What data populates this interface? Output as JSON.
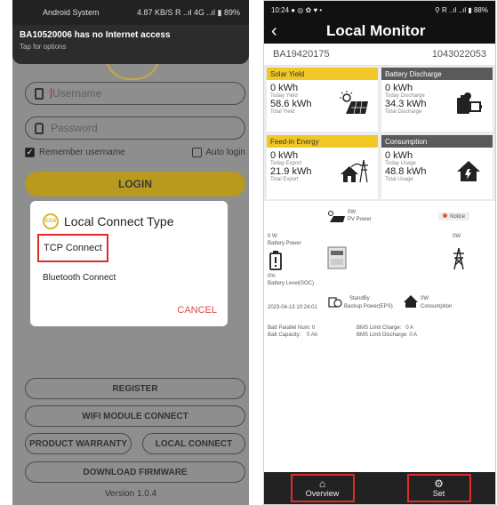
{
  "left": {
    "status_bar": {
      "app": "Android System",
      "speed": "4.87 KB/S",
      "battery": "89%"
    },
    "notification": {
      "title": "BA10520006 has no Internet access",
      "subtitle": "Tap for options"
    },
    "username_placeholder": "Username",
    "password_placeholder": "Password",
    "remember_label": "Remember username",
    "autologin_label": "Auto login",
    "login_label": "LOGIN",
    "dialog": {
      "title": "Local Connect Type",
      "logo_text": "EG4",
      "options": [
        "TCP Connect",
        "Bluetooth Connect"
      ],
      "cancel": "CANCEL"
    },
    "buttons": {
      "register": "REGISTER",
      "wifi": "WIFI MODULE CONNECT",
      "warranty": "PRODUCT WARRANTY",
      "local": "LOCAL CONNECT",
      "download": "DOWNLOAD FIRMWARE"
    },
    "version": "Version 1.0.4"
  },
  "right": {
    "status_bar": {
      "time": "10:24",
      "battery": "88%"
    },
    "title": "Local Monitor",
    "serial_left": "BA19420175",
    "serial_right": "1043022053",
    "cards": [
      {
        "header": "Solar Yield",
        "v1": "0 kWh",
        "l1": "Today Yield",
        "v2": "58.6 kWh",
        "l2": "Total Yield",
        "icon": "solar-panel-icon",
        "style": "yellow"
      },
      {
        "header": "Battery Discharge",
        "v1": "0 kWh",
        "l1": "Today Discharge",
        "v2": "34.3 kWh",
        "l2": "Total Discharge",
        "icon": "battery-discharge-icon",
        "style": "dark"
      },
      {
        "header": "Feed-in Energy",
        "v1": "0 kWh",
        "l1": "Today Export",
        "v2": "21.9 kWh",
        "l2": "Total Export",
        "icon": "grid-export-icon",
        "style": "yellow"
      },
      {
        "header": "Consumption",
        "v1": "0 kWh",
        "l1": "Today Usage",
        "v2": "48.8 kWh",
        "l2": "Total Usage",
        "icon": "home-consumption-icon",
        "style": "dark"
      }
    ],
    "flow": {
      "pv_value": "0W",
      "pv_label": "PV Power",
      "notice": "Notice",
      "battery_power_value": "0 W",
      "battery_power_label": "Battery Power",
      "grid_value": "0W",
      "soc_value": "0%",
      "soc_label": "Battery Level(SOC)",
      "standby": "StandBy",
      "eps_label": "Backup Power(EPS)",
      "consumption_value": "0W",
      "consumption_label": "Consumption",
      "timestamp": "2023-04-13 10:24:01",
      "batt_parallel": "Batt Parallel Num: 0",
      "batt_capacity_label": "Batt Capacity:",
      "batt_capacity_value": "0 Ah",
      "bms_charge_label": "BMS Limit Charge:",
      "bms_charge_value": "0 A",
      "bms_discharge": "BMS Limit Discharge: 0 A"
    },
    "nav": {
      "overview": "Overview",
      "set": "Set"
    }
  }
}
